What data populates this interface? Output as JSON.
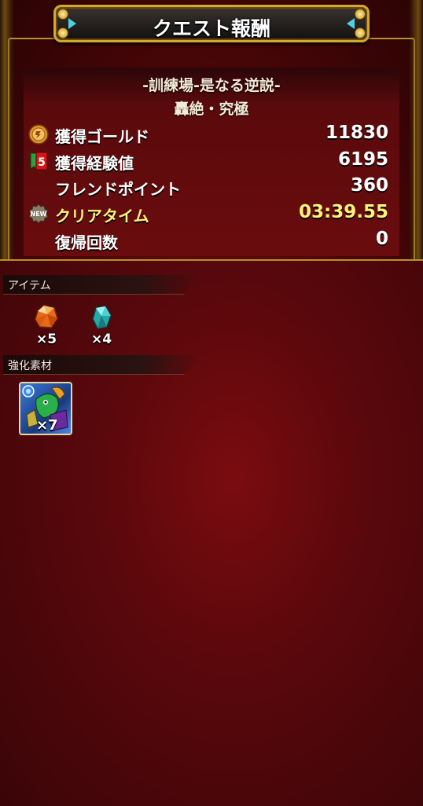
{
  "header": {
    "title": "クエスト報酬"
  },
  "quest": {
    "name": "-訓練場-是なる逆説-",
    "difficulty": "轟絶・究極"
  },
  "stats": [
    {
      "label": "獲得ゴールド",
      "value": "11830",
      "icon": "gold-coin-icon"
    },
    {
      "label": "獲得経験値",
      "value": "6195",
      "icon": "exp-badge-icon"
    },
    {
      "label": "フレンドポイント",
      "value": "360",
      "icon": ""
    },
    {
      "label": "クリアタイム",
      "value": "03:39.55",
      "icon": "new-badge-icon",
      "highlight": "#fff27a"
    },
    {
      "label": "復帰回数",
      "value": "0",
      "icon": ""
    }
  ],
  "items_section": {
    "title": "アイテム",
    "items": [
      {
        "icon": "orange-crystal-icon",
        "count": "×5"
      },
      {
        "icon": "blue-crystal-icon",
        "count": "×4"
      }
    ]
  },
  "materials_section": {
    "title": "強化素材",
    "items": [
      {
        "icon": "monster-card-icon",
        "count": "×7"
      }
    ]
  },
  "colors": {
    "gold_border": "#d4a830",
    "panel_red": "#6a0c0e",
    "highlight_yellow": "#fff27a"
  }
}
